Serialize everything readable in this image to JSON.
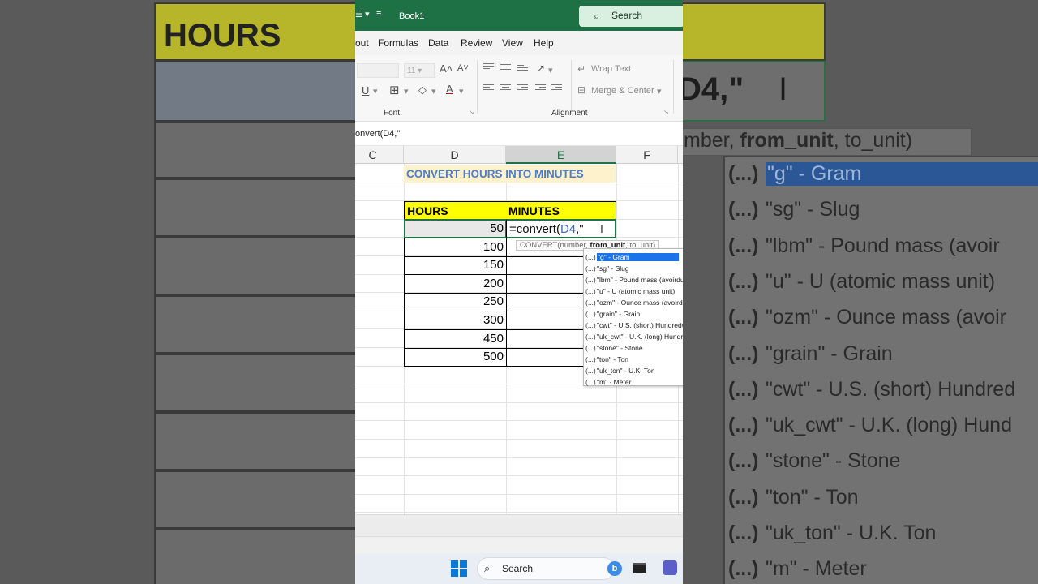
{
  "window": {
    "title": "Book1",
    "search_label": "Search"
  },
  "menu": {
    "items": [
      "out",
      "Formulas",
      "Data",
      "Review",
      "View",
      "Help"
    ]
  },
  "ribbon": {
    "font_size": "11",
    "wrap_text": "Wrap Text",
    "merge_center": "Merge & Center",
    "group_font": "Font",
    "group_alignment": "Alignment"
  },
  "formula_bar": {
    "content": "onvert(D4,\""
  },
  "columns": [
    "C",
    "D",
    "E",
    "F"
  ],
  "sheet": {
    "title": "CONVERT HOURS INTO MINUTES",
    "header_hours": "HOURS",
    "header_minutes": "MINUTES",
    "hours": [
      "50",
      "100",
      "150",
      "200",
      "250",
      "300",
      "450",
      "500"
    ],
    "editing_prefix": "=convert(",
    "editing_ref": "D4",
    "editing_suffix": ",\""
  },
  "tooltip": {
    "fn": "CONVERT(number, ",
    "bold": "from_unit",
    "rest": ", to_unit)"
  },
  "autocomplete": {
    "prefix": "(...)",
    "items": [
      "\"g\" - Gram",
      "\"sg\" - Slug",
      "\"lbm\" - Pound mass (avoirdupois)",
      "\"u\" - U (atomic mass unit)",
      "\"ozm\" - Ounce mass (avoirdupois)",
      "\"grain\" - Grain",
      "\"cwt\" - U.S. (short) Hundredweight",
      "\"uk_cwt\" - U.K. (long) Hundredweight",
      "\"stone\" - Stone",
      "\"ton\" - Ton",
      "\"uk_ton\" - U.K. Ton",
      "\"m\" - Meter"
    ],
    "selected_index": 0
  },
  "background": {
    "left_header": "HOURS",
    "right_formula": "D4,\"",
    "right_tooltip_bold": "from_unit",
    "right_tooltip_pre": "mber, ",
    "right_tooltip_post": ", to_unit)",
    "list_items": [
      "\"g\" - Gram",
      "\"sg\" - Slug",
      "\"lbm\" - Pound mass (avoir",
      "\"u\" - U (atomic mass unit)",
      "\"ozm\" - Ounce mass (avoir",
      "\"grain\" - Grain",
      "\"cwt\" - U.S. (short) Hundred",
      "\"uk_cwt\" - U.K. (long) Hund",
      "\"stone\" - Stone",
      "\"ton\" - Ton",
      "\"uk_ton\" - U.K. Ton",
      "\"m\" - Meter"
    ],
    "list_prefix": "(...)"
  },
  "taskbar": {
    "search_label": "Search"
  },
  "colors": {
    "excel_green": "#1e7145",
    "header_yellow": "#ffff00",
    "title_blue": "#4f7ec8",
    "selection_blue": "#1a73e8"
  }
}
